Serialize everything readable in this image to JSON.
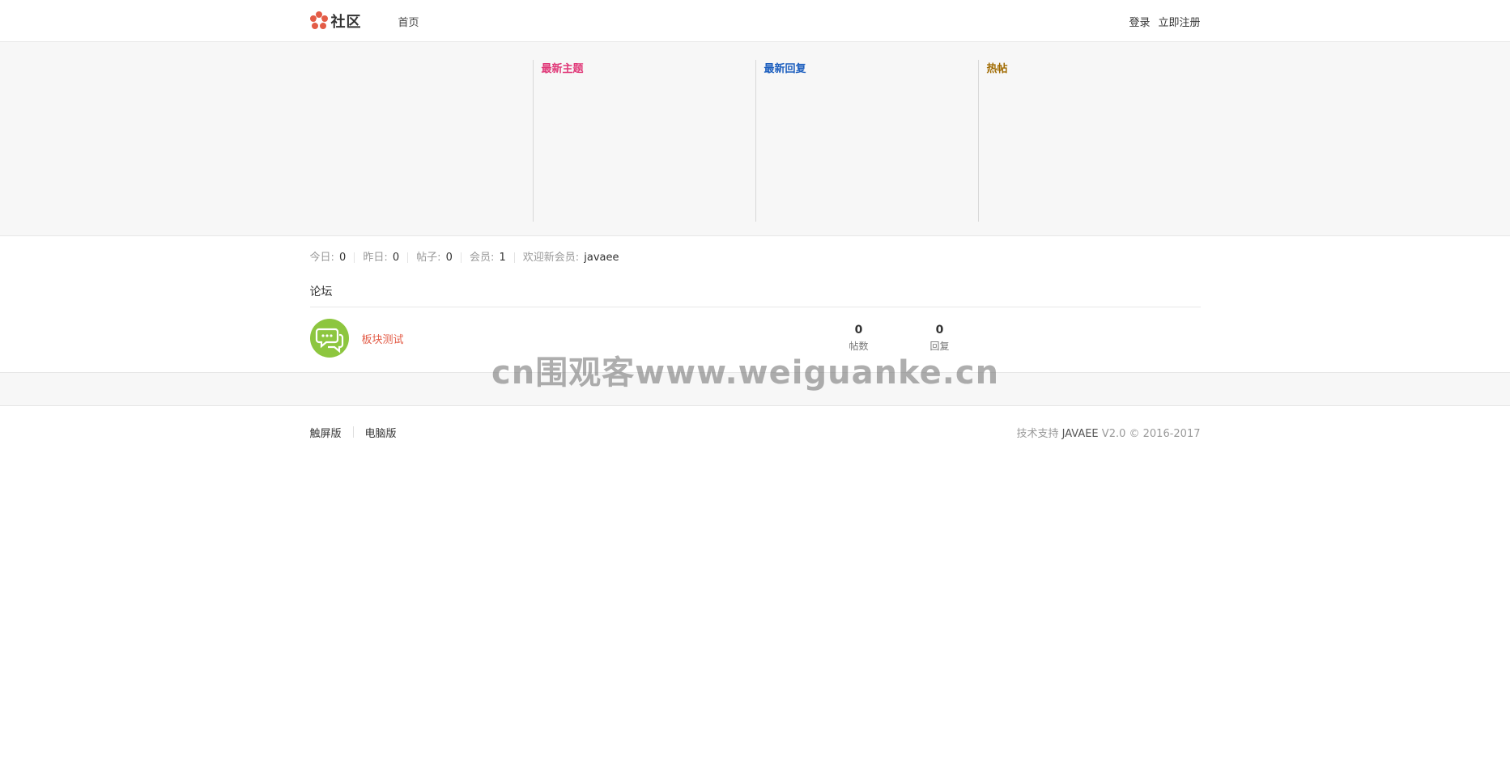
{
  "header": {
    "logo_text": "社区",
    "nav_home": "首页",
    "login": "登录",
    "register": "立即注册"
  },
  "panel": {
    "latest_topics_title": "最新主题",
    "latest_replies_title": "最新回复",
    "hot_posts_title": "热帖"
  },
  "stats": {
    "today_label": "今日:",
    "today_value": "0",
    "yesterday_label": "昨日:",
    "yesterday_value": "0",
    "posts_label": "帖子:",
    "posts_value": "0",
    "members_label": "会员:",
    "members_value": "1",
    "welcome_label": "欢迎新会员:",
    "welcome_user": "javaee"
  },
  "forum": {
    "section_title": "论坛",
    "boards": [
      {
        "name": "板块测试",
        "post_count": "0",
        "post_label": "帖数",
        "reply_count": "0",
        "reply_label": "回复"
      }
    ]
  },
  "watermark": "cn围观客www.weiguanke.cn",
  "footer": {
    "touch_version": "触屏版",
    "pc_version": "电脑版",
    "tech_support": "技术支持",
    "brand": "JAVAEE",
    "version_copyright": "V2.0 © 2016-2017"
  },
  "colors": {
    "latest_topics": "#e03878",
    "latest_replies": "#1d5fbf",
    "hot_posts": "#a06a00",
    "board_name": "#e35c47",
    "board_icon": "#8dc63f",
    "logo": "#e35c47"
  },
  "icons": {
    "logo": "flower-logo-icon",
    "board": "chat-bubbles-icon"
  }
}
